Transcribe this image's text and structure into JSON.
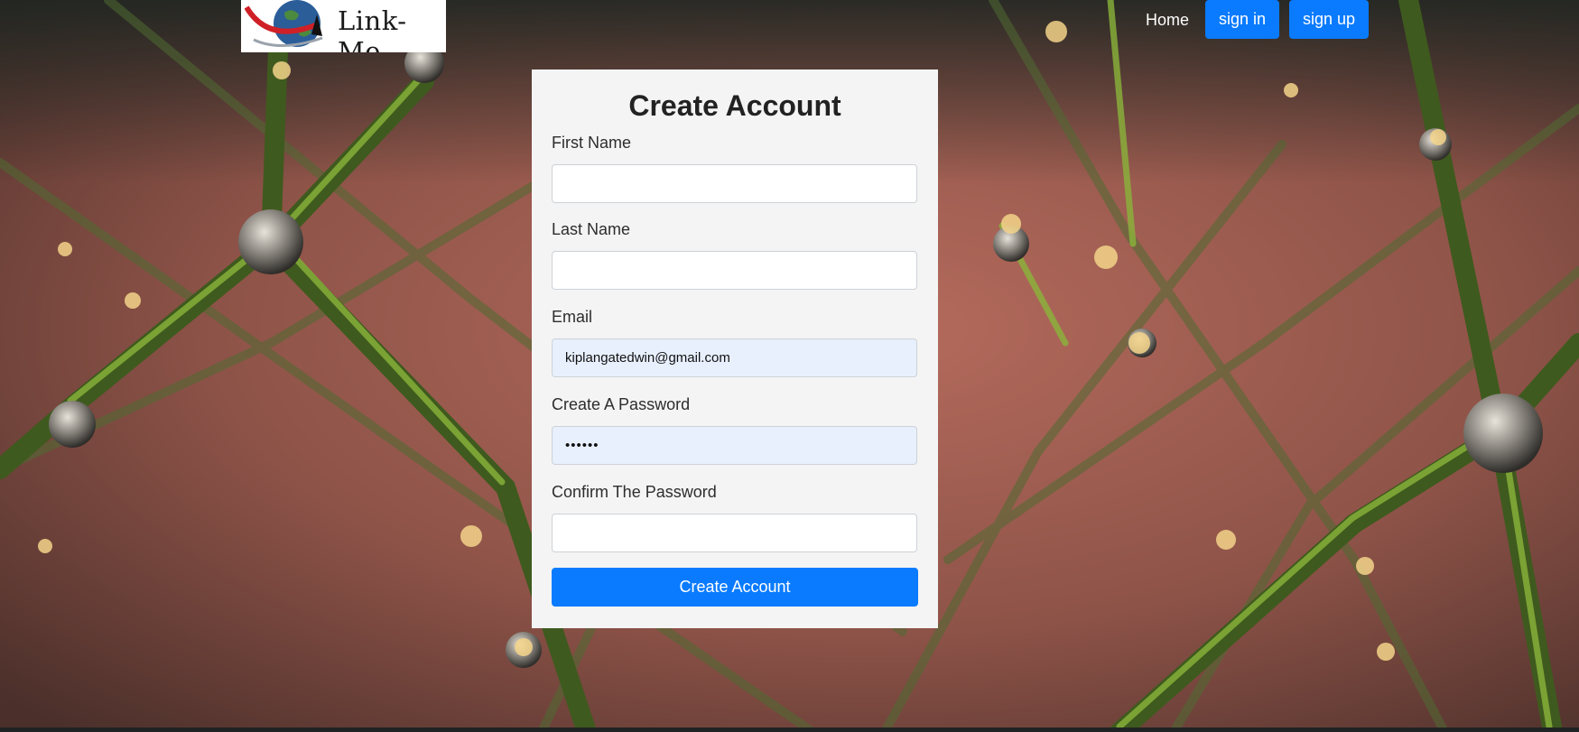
{
  "header": {
    "logo_text": "Link-Me",
    "nav": {
      "home_label": "Home",
      "signin_label": "sign in",
      "signup_label": "sign up"
    }
  },
  "form": {
    "title": "Create Account",
    "fields": [
      {
        "label": "First Name",
        "value": ""
      },
      {
        "label": "Last Name",
        "value": ""
      },
      {
        "label": "Email",
        "value": "kiplangatedwin@gmail.com"
      },
      {
        "label": "Create A Password",
        "value": "••••••"
      },
      {
        "label": "Confirm The Password",
        "value": ""
      }
    ],
    "submit_label": "Create Account"
  },
  "colors": {
    "primary_button": "#0a7bff",
    "card_background": "#f4f4f4",
    "autofill_background": "#e8f0fe"
  }
}
